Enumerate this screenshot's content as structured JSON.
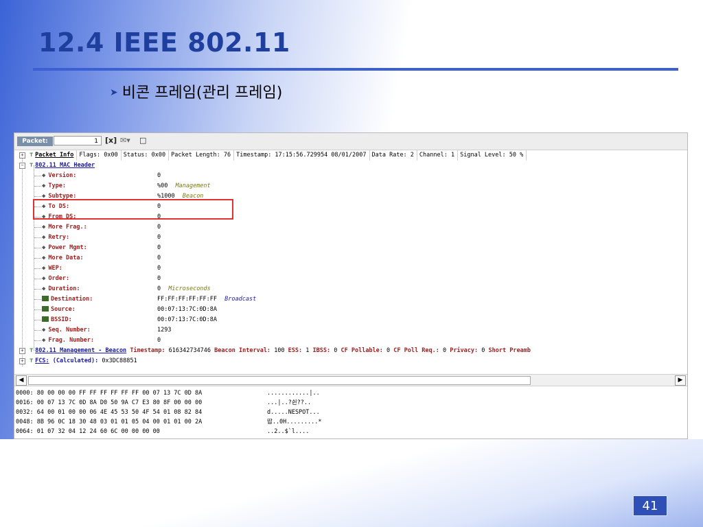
{
  "slide": {
    "title": "12.4 IEEE 802.11",
    "bullet": "비콘 프레임(관리 프레임)",
    "bullet_icon": "arrow-right-icon",
    "page_number": "41",
    "accent_color": "#3c60d4"
  },
  "toolbar": {
    "packet_label": "Packet:",
    "packet_value": "1",
    "icons": [
      "close-icon",
      "mail-icon",
      "document-icon"
    ]
  },
  "tree": {
    "packet_info": {
      "label": "Packet Info",
      "cells": [
        "Flags: 0x00",
        "Status: 0x00",
        "Packet Length: 76",
        "Timestamp: 17:15:56.729954 08/01/2007",
        "Data Rate: 2",
        "Channel: 1",
        "Signal Level: 50 %"
      ]
    },
    "mac_header": {
      "label": "802.11 MAC Header",
      "fields": [
        {
          "name": "Version:",
          "value": "0",
          "desc": ""
        },
        {
          "name": "Type:",
          "value": "%00",
          "desc": "Management"
        },
        {
          "name": "Subtype:",
          "value": "%1000",
          "desc": "Beacon"
        },
        {
          "name": "To DS:",
          "value": "0",
          "desc": ""
        },
        {
          "name": "From DS:",
          "value": "0",
          "desc": ""
        },
        {
          "name": "More Frag.:",
          "value": "0",
          "desc": ""
        },
        {
          "name": "Retry:",
          "value": "0",
          "desc": ""
        },
        {
          "name": "Power Mgmt:",
          "value": "0",
          "desc": ""
        },
        {
          "name": "More Data:",
          "value": "0",
          "desc": ""
        },
        {
          "name": "WEP:",
          "value": "0",
          "desc": ""
        },
        {
          "name": "Order:",
          "value": "0",
          "desc": ""
        },
        {
          "name": "Duration:",
          "value": "0",
          "desc": "Microseconds"
        },
        {
          "name": "Destination:",
          "value": "FF:FF:FF:FF:FF:FF",
          "desc": "Broadcast"
        },
        {
          "name": "Source:",
          "value": "00:07:13:7C:0D:8A",
          "desc": ""
        },
        {
          "name": "BSSID:",
          "value": "00:07:13:7C:0D:8A",
          "desc": ""
        },
        {
          "name": "Seq. Number:",
          "value": "1293",
          "desc": ""
        },
        {
          "name": "Frag. Number:",
          "value": "0",
          "desc": ""
        }
      ]
    },
    "management": {
      "label": "802.11 Management - Beacon",
      "parts": [
        {
          "k": "Timestamp:",
          "v": "616342734746"
        },
        {
          "k": "Beacon Interval:",
          "v": "100"
        },
        {
          "k": "ESS:",
          "v": "1"
        },
        {
          "k": "IBSS:",
          "v": "0"
        },
        {
          "k": "CF Pollable:",
          "v": "0"
        },
        {
          "k": "CF Poll Req.:",
          "v": "0"
        },
        {
          "k": "Privacy:",
          "v": "0"
        },
        {
          "k": "Short Preamb",
          "v": ""
        }
      ]
    },
    "fcs": {
      "label": "FCS:",
      "calc": "(Calculated):",
      "value": "0x3DC88851"
    }
  },
  "hex": {
    "rows": [
      {
        "off": "0000:",
        "bytes": "80 00 00 00 FF FF FF FF FF FF 00 07 13 7C 0D 8A",
        "ascii": "............|.."
      },
      {
        "off": "0016:",
        "bytes": "00 07 13 7C 0D 8A D0 50 9A C7 E3 80 8F 00 00 00",
        "ascii": "...|..?쉰??.."
      },
      {
        "off": "0032:",
        "bytes": "64 00 01 00 00 06 4E 45 53 50 4F 54 01 08 82 84",
        "ascii": "d.....NESPOT..."
      },
      {
        "off": "0048:",
        "bytes": "8B 96 0C 18 30 48 03 01 01 05 04 00 01 01 00 2A",
        "ascii": "땁..0H.........*"
      },
      {
        "off": "0064:",
        "bytes": "01 07 32 04 12 24 60 6C 00 00 00 00",
        "ascii": "..2..$`l...."
      }
    ]
  }
}
